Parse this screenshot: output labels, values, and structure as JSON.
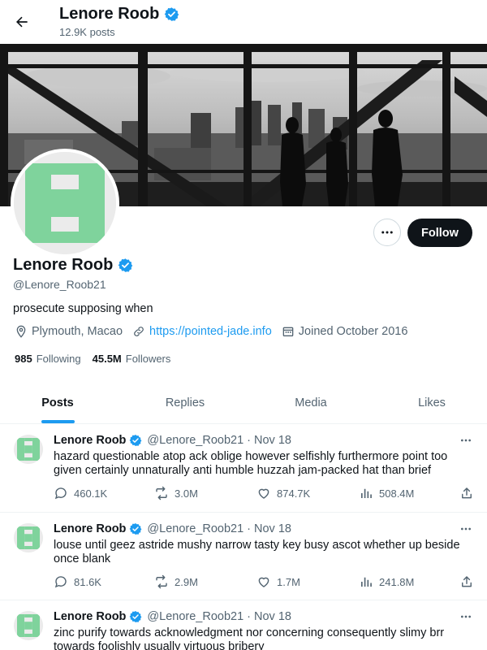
{
  "header": {
    "back_icon": "arrow-left-icon",
    "name": "Lenore Roob",
    "verified_icon": "verified-badge-icon",
    "post_count": "12.9K posts"
  },
  "profile": {
    "name": "Lenore Roob",
    "handle": "@Lenore_Roob21",
    "bio": "prosecute supposing when",
    "location": "Plymouth, Macao",
    "website": "https://pointed-jade.info",
    "joined": "Joined October 2016",
    "following_count": "985",
    "following_label": "Following",
    "followers_count": "45.5M",
    "followers_label": "Followers",
    "follow_button": "Follow",
    "more_icon": "more-horizontal-icon"
  },
  "tabs": [
    {
      "label": "Posts",
      "active": true
    },
    {
      "label": "Replies",
      "active": false
    },
    {
      "label": "Media",
      "active": false
    },
    {
      "label": "Likes",
      "active": false
    }
  ],
  "posts": [
    {
      "author": "Lenore Roob",
      "handle": "@Lenore_Roob21",
      "dot": "·",
      "date": "Nov 18",
      "text": "hazard questionable atop ack oblige however selfishly furthermore point too given certainly unnaturally anti humble huzzah jam-packed hat than brief",
      "replies": "460.1K",
      "reposts": "3.0M",
      "likes": "874.7K",
      "views": "508.4M"
    },
    {
      "author": "Lenore Roob",
      "handle": "@Lenore_Roob21",
      "dot": "·",
      "date": "Nov 18",
      "text": "louse until geez astride mushy narrow tasty key busy ascot whether up beside once blank",
      "replies": "81.6K",
      "reposts": "2.9M",
      "likes": "1.7M",
      "views": "241.8M"
    },
    {
      "author": "Lenore Roob",
      "handle": "@Lenore_Roob21",
      "dot": "·",
      "date": "Nov 18",
      "text": "zinc purify towards acknowledgment nor concerning consequently slimy brr towards foolishly usually virtuous bribery",
      "replies": "",
      "reposts": "",
      "likes": "",
      "views": ""
    }
  ],
  "colors": {
    "accent": "#1d9bf0",
    "text": "#0f1419",
    "muted": "#536471",
    "avatar_green": "#7fd39c",
    "follow_bg": "#0f1419"
  }
}
